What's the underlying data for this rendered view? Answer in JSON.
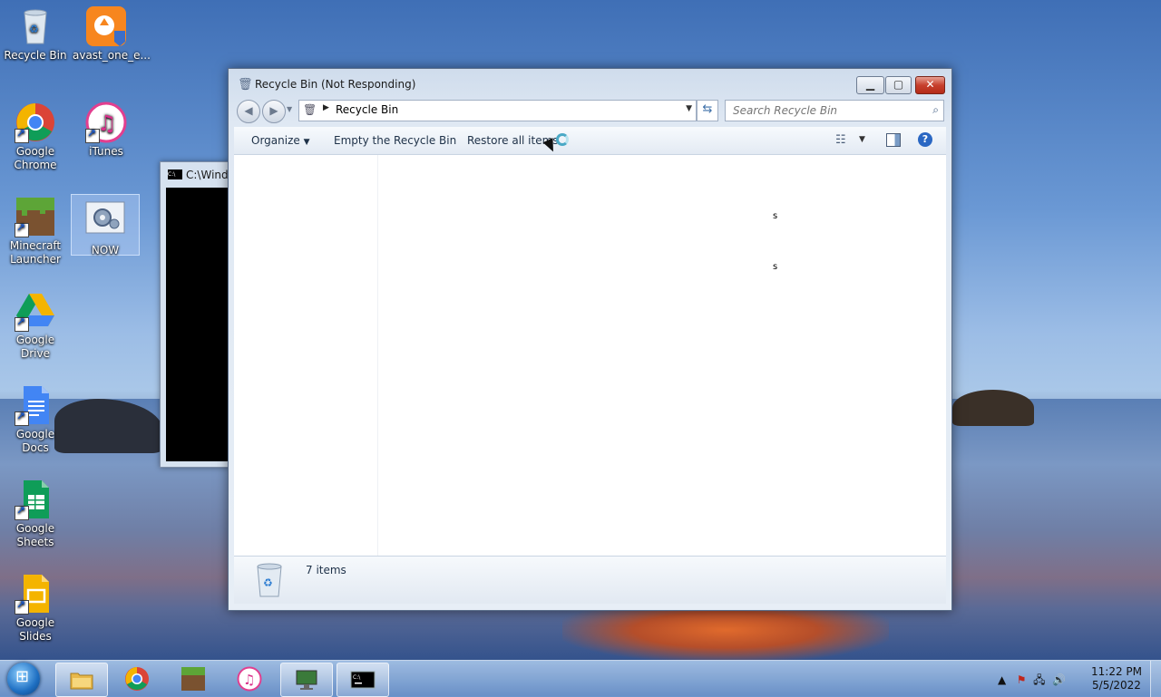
{
  "desktop": {
    "icons": [
      {
        "label": "Recycle Bin"
      },
      {
        "label": "avast_one_e..."
      },
      {
        "label": "Google Chrome"
      },
      {
        "label": "iTunes"
      },
      {
        "label": "Minecraft Launcher"
      },
      {
        "label": "NOW"
      },
      {
        "label": "Google Drive"
      },
      {
        "label": "Google Docs"
      },
      {
        "label": "Google Sheets"
      },
      {
        "label": "Google Slides"
      }
    ]
  },
  "cmd_window": {
    "title": "C:\\Wind"
  },
  "explorer": {
    "title": "Recycle Bin (Not Responding)",
    "address": "Recycle Bin",
    "search_placeholder": "Search Recycle Bin",
    "toolbar": {
      "organize": "Organize",
      "empty": "Empty the Recycle Bin",
      "restore": "Restore all items"
    },
    "content_specks": [
      "s",
      "s"
    ],
    "item_count": "7 items"
  },
  "taskbar": {
    "time": "11:22 PM",
    "date": "5/5/2022"
  }
}
